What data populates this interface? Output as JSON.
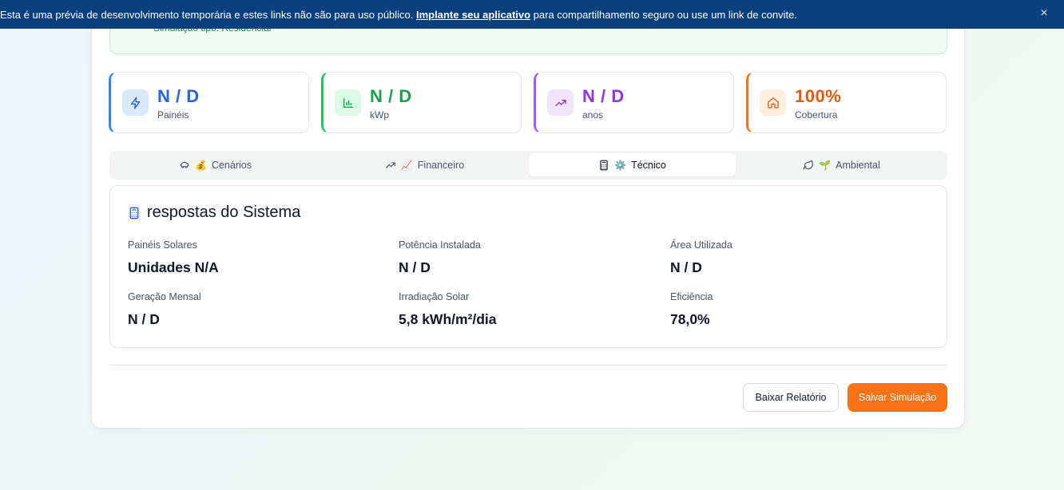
{
  "banner": {
    "text_before": "Esta é uma prévia de desenvolvimento temporária e estes links não são para uso público. ",
    "link_label": "Implante seu aplicativo",
    "text_after": " para compartilhamento seguro ou use um link de convite.",
    "close_icon": "×"
  },
  "result": {
    "sim_type": "Simulação tipo: Residencial"
  },
  "stats": [
    {
      "value": "N / D",
      "label": "Painéis",
      "icon": "lightning-icon",
      "color": "#2563eb"
    },
    {
      "value": "N / D",
      "label": "kWp",
      "icon": "bar-chart-icon",
      "color": "#16a34a"
    },
    {
      "value": "N / D",
      "label": "anos",
      "icon": "trending-up-icon",
      "color": "#9333ea"
    },
    {
      "value": "100%",
      "label": "Cobertura",
      "icon": "home-icon",
      "color": "#ea580c"
    }
  ],
  "tabs": [
    {
      "label": "Cenários",
      "emoji": "💰",
      "icon": "piggy-bank-icon"
    },
    {
      "label": "Financeiro",
      "emoji": "📈",
      "icon": "trending-up-icon"
    },
    {
      "label": "Técnico",
      "emoji": "⚙️",
      "icon": "calculator-icon",
      "active": true
    },
    {
      "label": "Ambiental",
      "emoji": "🌱",
      "icon": "leaf-icon"
    }
  ],
  "panel": {
    "title": "respostas do Sistema",
    "fields": [
      {
        "label": "Painéis Solares",
        "value": "Unidades N/A"
      },
      {
        "label": "Potência Instalada",
        "value": "N / D"
      },
      {
        "label": "Área Utilizada",
        "value": "N / D"
      },
      {
        "label": "Geração Mensal",
        "value": "N / D"
      },
      {
        "label": "Irradiação Solar",
        "value": "5,8 kWh/m²/dia"
      },
      {
        "label": "Eficiência",
        "value": "78,0%"
      }
    ]
  },
  "actions": {
    "download_label": "Baixar Relatório",
    "save_label": "Salvar Simulação"
  },
  "colors": {
    "banner": "#0b3f7e",
    "accent_orange": "#f97316"
  }
}
